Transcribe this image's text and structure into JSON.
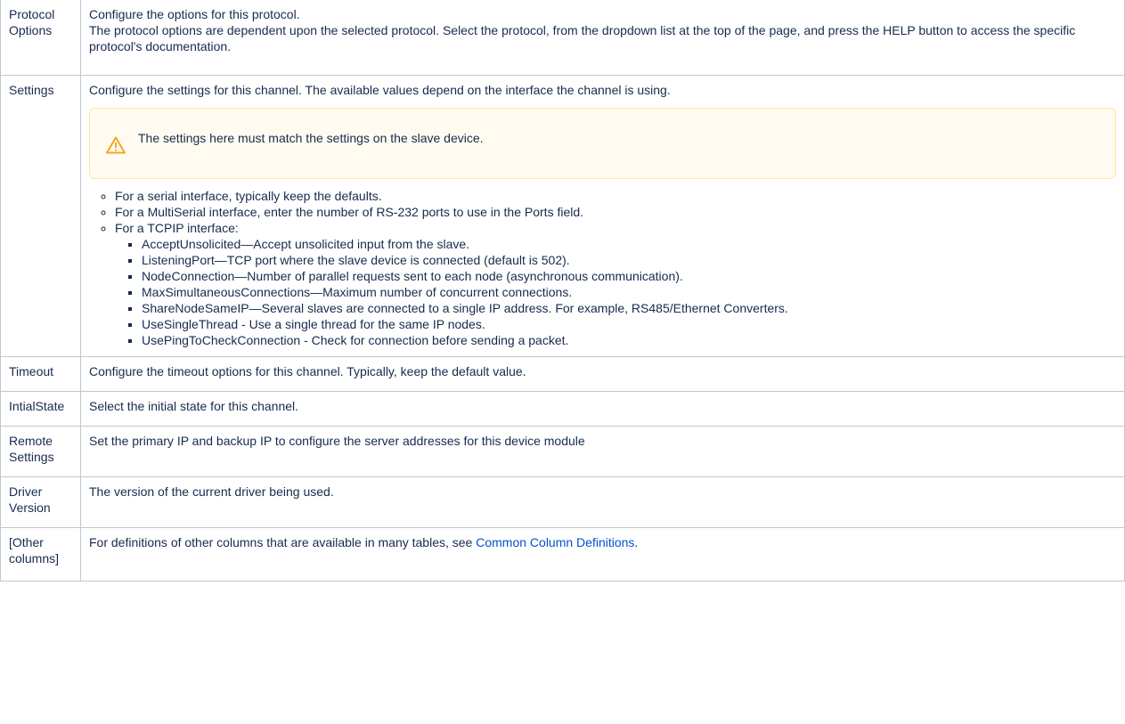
{
  "rows": [
    {
      "name": "Protocol Options",
      "lines": [
        "Configure the options for this protocol.",
        "The protocol options are dependent upon the selected protocol. Select the protocol, from the dropdown list at the top of the page, and press the HELP button to access the specific protocol's documentation."
      ]
    },
    {
      "name": "Settings",
      "intro": "Configure the settings for this channel. The available values depend on the interface the channel is using.",
      "warning": "The settings here must match the settings on the slave device.",
      "bullets": [
        "For a serial interface, typically keep the defaults.",
        "For a MultiSerial interface, enter the number of RS-232 ports to use in the Ports field.",
        "For a TCPIP interface:"
      ],
      "sub_bullets": [
        "AcceptUnsolicited—Accept unsolicited input from the slave.",
        "ListeningPort—TCP port where the slave device is connected (default is 502).",
        "NodeConnection—Number of parallel requests sent to each node (asynchronous communication).",
        "MaxSimultaneousConnections—Maximum number of concurrent connections.",
        "ShareNodeSameIP—Several slaves are connected to a single IP address. For example, RS485/Ethernet Converters.",
        "UseSingleThread - Use a single thread for the same IP nodes.",
        "UsePingToCheckConnection - Check for connection before sending a packet."
      ]
    },
    {
      "name": "Timeout",
      "text": "Configure the timeout options for this channel. Typically, keep the default value."
    },
    {
      "name": "IntialState",
      "text": "Select the initial state for this channel."
    },
    {
      "name": "Remote Settings",
      "text": "Set the primary IP and backup IP to configure the server addresses for this device module"
    },
    {
      "name": "Driver Version",
      "text": "The version of the current driver being used."
    },
    {
      "name": "[Other columns]",
      "text_before": "For definitions of other columns that are available in many tables, see ",
      "link": "Common Column Definitions",
      "text_after": "."
    }
  ],
  "colors": {
    "text": "#172b4d",
    "border": "#c1c7d0",
    "link": "#0052cc",
    "warning_bg": "#fffbf0",
    "warning_border": "#ffe7a1",
    "warning_icon": "#f5a623"
  }
}
